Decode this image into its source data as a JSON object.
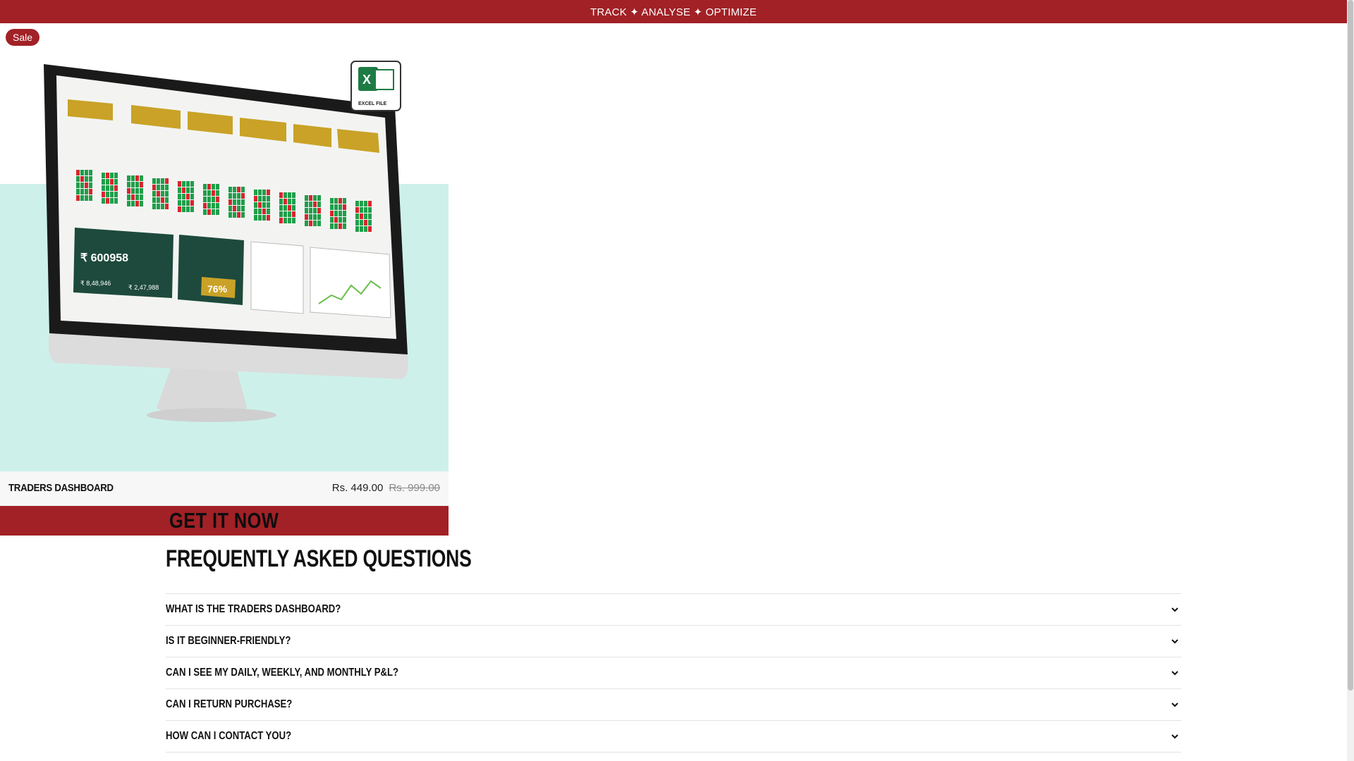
{
  "announcement": {
    "text": "TRACK ✦ ANALYSE ✦ OPTIMIZE"
  },
  "product": {
    "badge": "Sale",
    "name": "TRADERS DASHBOARD",
    "price": "Rs. 449.00",
    "compare_price": "Rs. 999.00",
    "cta_label": "GET IT NOW",
    "image": {
      "file_label": "EXCEL FILE",
      "kpi_total": "₹ 600958",
      "percent": "76%",
      "stat_a": "₹ 8,48,946",
      "stat_b": "₹ 2,47,988"
    }
  },
  "faq": {
    "title": "FREQUENTLY ASKED QUESTIONS",
    "items": [
      {
        "question": "WHAT IS THE TRADERS DASHBOARD?"
      },
      {
        "question": "IS IT BEGINNER-FRIENDLY?"
      },
      {
        "question": "CAN I SEE MY DAILY, WEEKLY, AND MONTHLY P&L?"
      },
      {
        "question": "CAN I RETURN PURCHASE?"
      },
      {
        "question": "HOW CAN I CONTACT YOU?"
      }
    ]
  },
  "colors": {
    "brand": "#a12126",
    "image_bg": "#cdf1ea",
    "dashboard_green": "#1d4a3c",
    "dashboard_gold": "#c9a227"
  },
  "icons": {
    "faq_toggle": "chevron-down-icon",
    "file": "excel-icon"
  }
}
